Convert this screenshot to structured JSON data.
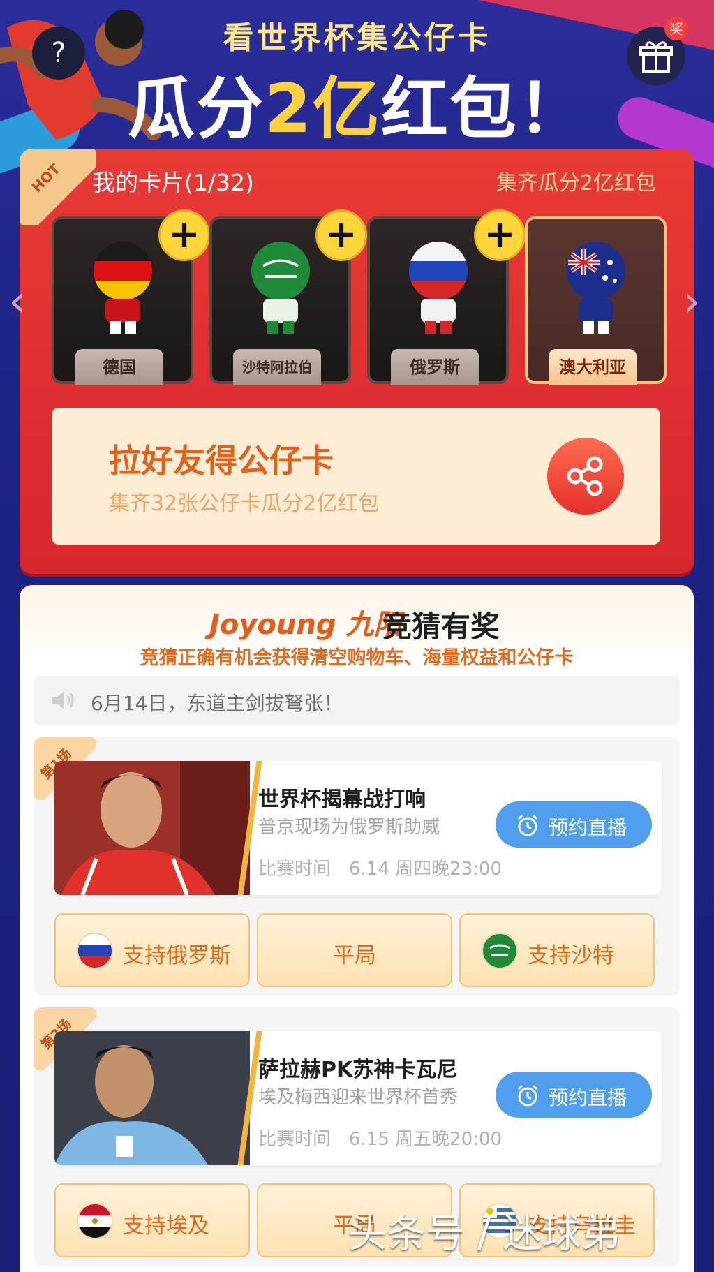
{
  "header": {
    "help_icon": "?",
    "subtitle": "看世界杯集公仔卡",
    "title_prefix": "瓜分",
    "title_amount": "2亿",
    "title_suffix": "红包！",
    "gift_badge": "奖"
  },
  "cards": {
    "hot_label": "HOT",
    "title": "我的卡片(1/32)",
    "hint": "集齐瓜分2亿红包",
    "prev_arrow": "‹",
    "next_arrow": "›",
    "items": [
      {
        "label": "德国",
        "owned": false
      },
      {
        "label": "沙特阿拉伯",
        "owned": false
      },
      {
        "label": "俄罗斯",
        "owned": false
      },
      {
        "label": "澳大利亚",
        "owned": true
      }
    ],
    "plus_label": "+"
  },
  "invite": {
    "title": "拉好友得公仔卡",
    "subtitle": "集齐32张公仔卡瓜分2亿红包"
  },
  "quiz": {
    "brand": "Joyoung 九阳",
    "title": "竞猜有奖",
    "subtitle": "竞猜正确有机会获得清空购物车、海量权益和公仔卡",
    "notice": "6月14日，东道主剑拔弩张！",
    "matches": [
      {
        "no": "第1场",
        "title": "世界杯揭幕战打响",
        "desc": "普京现场为俄罗斯助威",
        "time": "比赛时间　6.14 周四晚23:00",
        "remind": "预约直播",
        "bets": [
          "支持俄罗斯",
          "平局",
          "支持沙特"
        ]
      },
      {
        "no": "第2场",
        "title": "萨拉赫PK苏神卡瓦尼",
        "desc": "埃及梅西迎来世界杯首秀",
        "time": "比赛时间　6.15 周五晚20:00",
        "remind": "预约直播",
        "bets": [
          "支持埃及",
          "平局",
          "支持乌拉圭"
        ]
      }
    ]
  },
  "watermark": "头条号 / 迷球弟",
  "colors": {
    "panel_red": "#e12f33",
    "accent_orange": "#e2621d",
    "remind_blue": "#4f9fee",
    "gold": "#ffd63a"
  }
}
